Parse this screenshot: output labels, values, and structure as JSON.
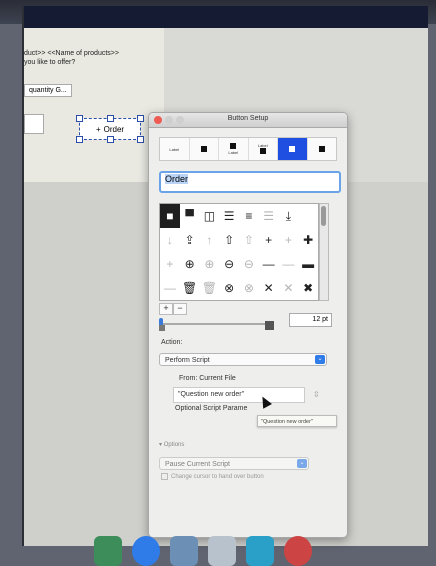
{
  "layout_canvas": {
    "text_line1": "duct>> <<Name of products>>",
    "text_line2": " you like to offer?",
    "quantity_field": "quantity G...",
    "order_button_label": "Order",
    "order_button_icon": "plus-icon"
  },
  "panel": {
    "title": "Button Setup",
    "button_styles": [
      {
        "label": "Label",
        "name": "style-label-only"
      },
      {
        "label": "",
        "name": "style-icon-only"
      },
      {
        "label": "Label",
        "name": "style-icon-above-label"
      },
      {
        "label": "Label",
        "name": "style-label-above-icon"
      },
      {
        "label": "Label",
        "name": "style-icon-left-label"
      },
      {
        "label": "Label",
        "name": "style-label-left-icon"
      }
    ],
    "button_label_value": "Order",
    "icon_size_value": "12 pt",
    "add_icon": "+",
    "remove_icon": "−",
    "action_label": "Action:",
    "action_value": "Perform Script",
    "from_label": "From: Current File",
    "script_value": "\"Question new order\"",
    "optional_param_label": "Optional Script Parame",
    "tooltip_text": "\"Question new order\"",
    "options_label": "Options",
    "pause_value": "Pause Current Script",
    "cursor_label": "Change cursor to hand over button"
  },
  "icon_grid": [
    {
      "glyph": "■",
      "name": "square-filled-icon",
      "sel": true
    },
    {
      "glyph": "▀",
      "name": "square-top-icon"
    },
    {
      "glyph": "◫",
      "name": "columns-icon"
    },
    {
      "glyph": "☰",
      "name": "list-icon"
    },
    {
      "glyph": "≡",
      "name": "menu-icon"
    },
    {
      "glyph": "☰",
      "name": "lines-icon",
      "light": true
    },
    {
      "glyph": "⤓",
      "name": "download-icon"
    },
    {
      "glyph": "",
      "name": "blank-icon"
    },
    {
      "glyph": "↓",
      "name": "arrow-down-icon",
      "light": true
    },
    {
      "glyph": "⇪",
      "name": "upload-icon"
    },
    {
      "glyph": "↑",
      "name": "arrow-up-icon",
      "light": true
    },
    {
      "glyph": "⇧",
      "name": "upload-outline-icon"
    },
    {
      "glyph": "⇧",
      "name": "upload-light-icon",
      "light": true
    },
    {
      "glyph": "+",
      "name": "plus-box-icon"
    },
    {
      "glyph": "+",
      "name": "plus-light-icon",
      "light": true
    },
    {
      "glyph": "✚",
      "name": "plus-bold-icon"
    },
    {
      "glyph": "+",
      "name": "plus-thin-icon",
      "light": true
    },
    {
      "glyph": "⊕",
      "name": "plus-circle-filled-icon"
    },
    {
      "glyph": "⊕",
      "name": "plus-circle-icon",
      "light": true
    },
    {
      "glyph": "⊖",
      "name": "minus-circle-filled-icon"
    },
    {
      "glyph": "⊖",
      "name": "minus-circle-icon",
      "light": true
    },
    {
      "glyph": "—",
      "name": "minus-bold-icon"
    },
    {
      "glyph": "—",
      "name": "minus-light-icon",
      "light": true
    },
    {
      "glyph": "▬",
      "name": "minus-thick-icon"
    },
    {
      "glyph": "—",
      "name": "dash-icon",
      "light": true
    },
    {
      "glyph": "🗑",
      "name": "trash-filled-icon"
    },
    {
      "glyph": "🗑",
      "name": "trash-outline-icon",
      "light": true
    },
    {
      "glyph": "⊗",
      "name": "close-circle-filled-icon"
    },
    {
      "glyph": "⊗",
      "name": "close-circle-icon",
      "light": true
    },
    {
      "glyph": "✕",
      "name": "close-icon"
    },
    {
      "glyph": "✕",
      "name": "close-light-icon",
      "light": true
    },
    {
      "glyph": "✖",
      "name": "close-bold-icon"
    }
  ],
  "colors": {
    "accent": "#1f4fe0",
    "select_arrow": "#2f7be7"
  }
}
